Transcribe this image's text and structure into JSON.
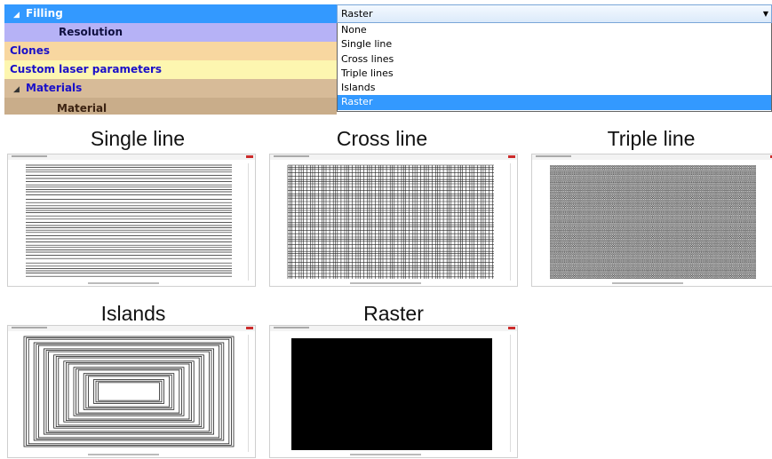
{
  "grid": {
    "rows": [
      {
        "label": "Filling",
        "expanded": true
      },
      {
        "label": "Resolution"
      },
      {
        "label": "Clones"
      },
      {
        "label": "Custom laser parameters"
      },
      {
        "label": "Materials",
        "expanded": true
      },
      {
        "label": "Material"
      }
    ],
    "expand_glyph": "◢"
  },
  "filling_combo": {
    "value": "Raster",
    "arrow": "▼",
    "options": [
      "None",
      "Single line",
      "Cross lines",
      "Triple lines",
      "Islands",
      "Raster"
    ],
    "selected_index": 5
  },
  "previews": [
    {
      "caption": "Single line",
      "pattern": "single-line"
    },
    {
      "caption": "Cross line",
      "pattern": "cross-line"
    },
    {
      "caption": "Triple line",
      "pattern": "triple-line"
    },
    {
      "caption": "Islands",
      "pattern": "islands"
    },
    {
      "caption": "Raster",
      "pattern": "raster"
    }
  ],
  "colors": {
    "selection": "#3399ff",
    "resolution_row": "#b6b2f6",
    "clones_row": "#f8d7a0",
    "custom_row": "#fdf6b0",
    "materials_row": "#d7bb98",
    "label_text": "#1a10c8"
  }
}
